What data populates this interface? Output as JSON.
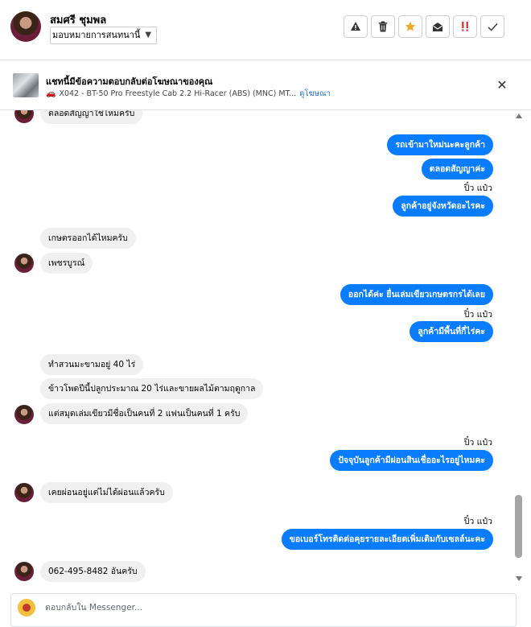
{
  "header": {
    "user_name": "สมศรี ชุมพล",
    "assign_label": "มอบหมายการสนทนานี้",
    "actions": [
      "spam",
      "delete",
      "star",
      "mark-unread",
      "important",
      "done"
    ]
  },
  "ad": {
    "title": "แชทนี้มีข้อความตอบกลับต่อโฆษณาของคุณ",
    "subtitle": "X042 - BT-50 Pro Freestyle Cab 2.2 Hi-Racer (ABS) (MNC) MT...",
    "link": "ดูโฆษณา"
  },
  "messages": {
    "m0": "ตลอดสัญญาใช่ไหมครับ",
    "m1": "รถเข้ามาใหม่นะคะลูกค้า",
    "m2": "ตลอดสัญญาค่ะ",
    "s1": "ปิ๋ว แป๋ว",
    "m3": "ลูกค้าอยู่จังหวัดอะไรคะ",
    "m4": "เกษตรออกได้ไหมครับ",
    "m5": "เพชรบูรณ์",
    "m6": "ออกได้ค่ะ ยื่นเล่มเขียวเกษตรกรได้เลย",
    "s2": "ปิ๋ว แป๋ว",
    "m7": "ลูกค้ามีพื้นที่กี่ไร่คะ",
    "m8": "ทำสวนมะขามอยู่ 40 ไร่",
    "m9": "ข้าวโพดปีนี้ปลูกประมาณ 20 ไร่และขายผลไม้ตามฤดูกาล",
    "m10": "แต่สมุดเล่มเขียวมีชื่อเป็นคนที่ 2 แฟนเป็นคนที่ 1 ครับ",
    "s3": "ปิ๋ว แป๋ว",
    "m11": "ปัจจุบันลูกค้ามีผ่อนสินเชื่ออะไรอยู่ไหมคะ",
    "m12": "เคยผ่อนอยู่แต่ไม่ได้ผ่อนแล้วครับ",
    "s4": "ปิ๋ว แป๋ว",
    "m13": "ขอเบอร์โทรติดต่อคุยรายละเอียดเพิ่มเติมกับเซลล์นะคะ",
    "m14": "062-495-8482 อันครับ"
  },
  "composer": {
    "placeholder": "ตอบกลับใน Messenger..."
  },
  "colors": {
    "outgoing_bubble": "#0a7cff",
    "incoming_bubble": "#f0f0f0",
    "star": "#f5a623",
    "important": "#d9272e"
  }
}
